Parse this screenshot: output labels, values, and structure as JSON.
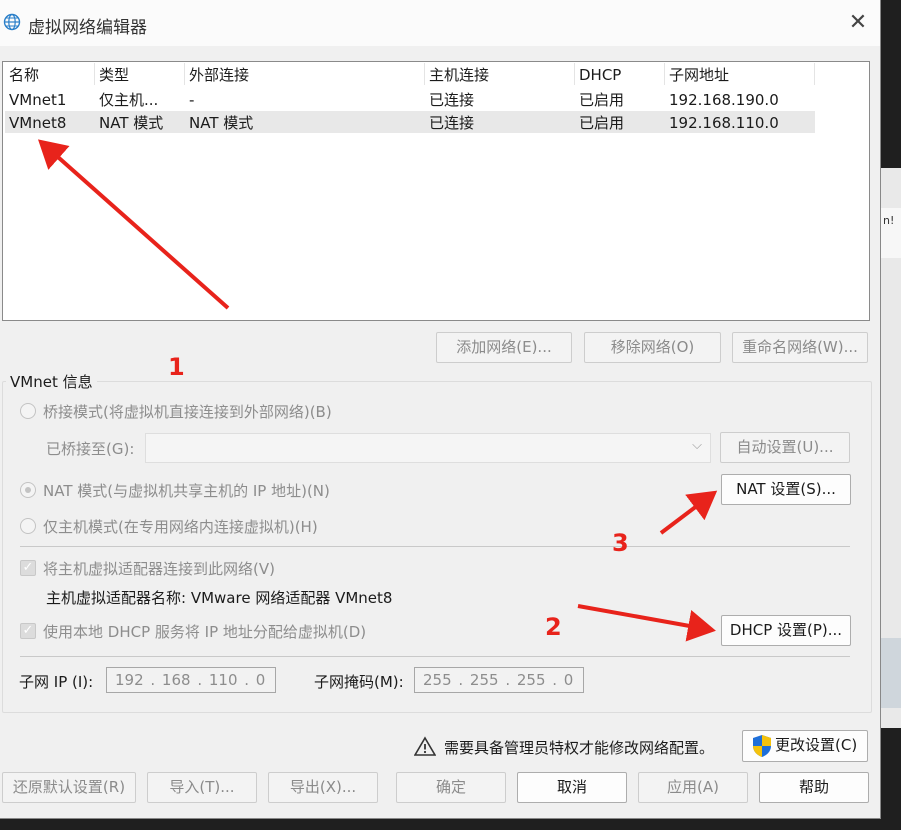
{
  "window": {
    "title": "虚拟网络编辑器",
    "close_icon": "close-icon"
  },
  "network_list": {
    "columns": [
      "名称",
      "类型",
      "外部连接",
      "主机连接",
      "DHCP",
      "子网地址"
    ],
    "rows": [
      {
        "name": "VMnet1",
        "type": "仅主机...",
        "external": "-",
        "host": "已连接",
        "dhcp": "已启用",
        "subnet": "192.168.190.0",
        "selected": false
      },
      {
        "name": "VMnet8",
        "type": "NAT 模式",
        "external": "NAT 模式",
        "host": "已连接",
        "dhcp": "已启用",
        "subnet": "192.168.110.0",
        "selected": true
      }
    ]
  },
  "list_buttons": {
    "add": "添加网络(E)...",
    "remove": "移除网络(O)",
    "rename": "重命名网络(W)..."
  },
  "vmnet_info": {
    "group_label": "VMnet 信息",
    "bridge_radio": "桥接模式(将虚拟机直接连接到外部网络)(B)",
    "bridged_to_label": "已桥接至(G):",
    "bridged_to_value": "",
    "auto_settings": "自动设置(U)...",
    "nat_radio": "NAT 模式(与虚拟机共享主机的 IP 地址)(N)",
    "nat_settings": "NAT 设置(S)...",
    "hostonly_radio": "仅主机模式(在专用网络内连接虚拟机)(H)",
    "connect_adapter_check": "将主机虚拟适配器连接到此网络(V)",
    "adapter_name_label": "主机虚拟适配器名称: VMware 网络适配器 VMnet8",
    "dhcp_check": "使用本地 DHCP 服务将 IP 地址分配给虚拟机(D)",
    "dhcp_settings": "DHCP 设置(P)...",
    "subnet_ip_label": "子网 IP (I):",
    "subnet_ip_value": "192 . 168 . 110 .  0",
    "subnet_mask_label": "子网掩码(M):",
    "subnet_mask_value": "255 . 255 . 255 .  0",
    "selected_mode": "nat"
  },
  "admin": {
    "notice": "需要具备管理员特权才能修改网络配置。",
    "change_settings": "更改设置(C)",
    "warning_icon": "warning-icon",
    "shield_icon": "uac-shield-icon"
  },
  "footer": {
    "restore": "还原默认设置(R)",
    "import": "导入(T)...",
    "export": "导出(X)...",
    "ok": "确定",
    "cancel": "取消",
    "apply": "应用(A)",
    "help": "帮助"
  },
  "annotations": {
    "n1": "1",
    "n2": "2",
    "n3": "3",
    "color": "#e8231b"
  },
  "background_window": {
    "fragment": "n!"
  }
}
